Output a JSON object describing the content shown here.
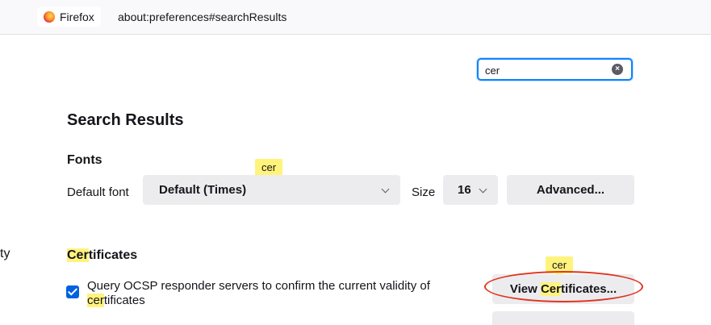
{
  "browser": {
    "identity_label": "Firefox",
    "url": "about:preferences#searchResults"
  },
  "search": {
    "value": "cer",
    "clear_icon": "clear-icon"
  },
  "results": {
    "title": "Search Results"
  },
  "fonts": {
    "heading": "Fonts",
    "tooltip": "cer",
    "default_font_label": "Default font",
    "default_font_value": "Default (Times)",
    "size_label": "Size",
    "size_value": "16",
    "advanced_button": "Advanced..."
  },
  "sidebar": {
    "fragment": "ty"
  },
  "certificates": {
    "heading_match": "Cer",
    "heading_rest": "tificates",
    "ocsp_text": "Query OCSP responder servers to confirm the current validity of",
    "ocsp_match": "cer",
    "ocsp_rest": "tificates",
    "ocsp_checked": true,
    "tooltip": "cer",
    "view_prefix": "View ",
    "view_match": "Cer",
    "view_rest": "tificates...",
    "annotation_color": "#e0351f",
    "highlight_color": "#fff37c"
  }
}
